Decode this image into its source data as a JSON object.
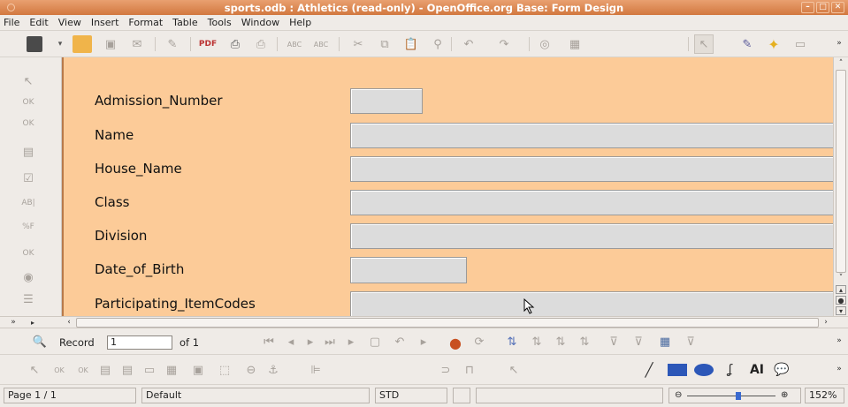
{
  "window": {
    "title": "sports.odb : Athletics (read-only) - OpenOffice.org Base: Form Design"
  },
  "menu": [
    "File",
    "Edit",
    "View",
    "Insert",
    "Format",
    "Table",
    "Tools",
    "Window",
    "Help"
  ],
  "form": {
    "fields": [
      {
        "label": "Admission_Number"
      },
      {
        "label": "Name"
      },
      {
        "label": "House_Name"
      },
      {
        "label": "Class"
      },
      {
        "label": "Division"
      },
      {
        "label": "Date_of_Birth"
      },
      {
        "label": "Participating_ItemCodes"
      }
    ],
    "background_color": "#fccb98"
  },
  "navigation": {
    "record_label": "Record",
    "record_value": "1",
    "of_label": "of 1"
  },
  "status": {
    "page": "Page 1 / 1",
    "style": "Default",
    "mode": "STD",
    "zoom": "152%"
  },
  "colors": {
    "titlebar": "#d2783f",
    "form_bg": "#fccb98",
    "field_bg": "#dcdcdc"
  }
}
